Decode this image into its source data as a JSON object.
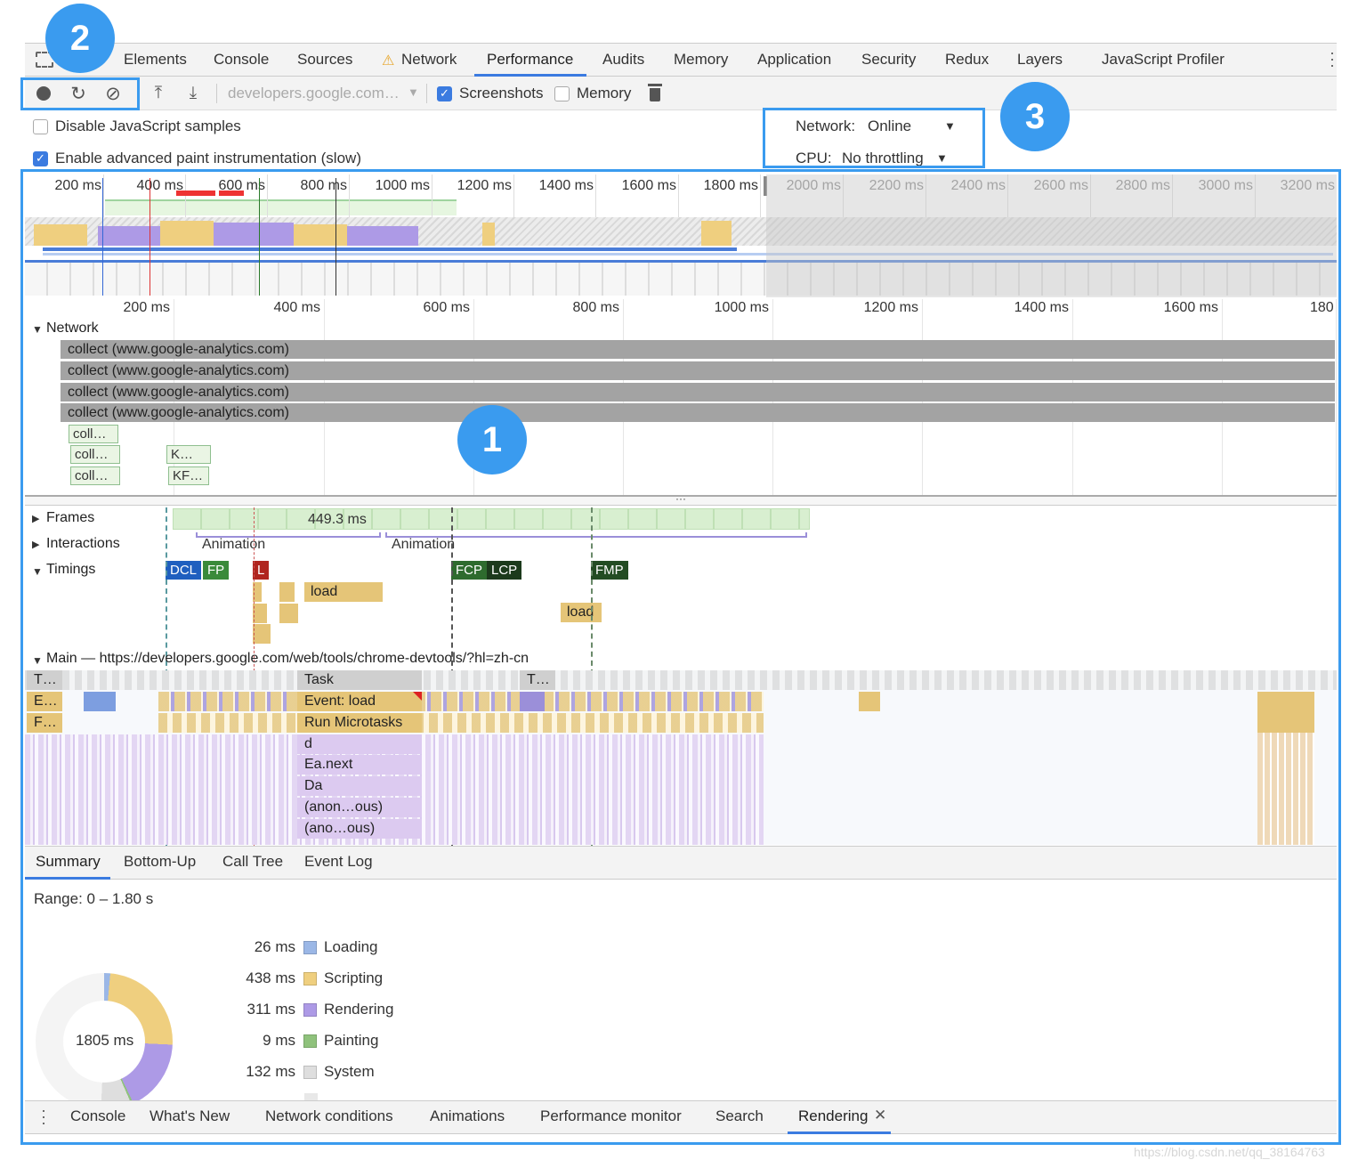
{
  "tabs": [
    {
      "label": "Elements",
      "name": "tab-elements"
    },
    {
      "label": "Console",
      "name": "tab-console"
    },
    {
      "label": "Sources",
      "name": "tab-sources"
    },
    {
      "label": "Network",
      "name": "tab-network",
      "warning": true
    },
    {
      "label": "Performance",
      "name": "tab-performance",
      "active": true
    },
    {
      "label": "Audits",
      "name": "tab-audits"
    },
    {
      "label": "Memory",
      "name": "tab-memory"
    },
    {
      "label": "Application",
      "name": "tab-application"
    },
    {
      "label": "Security",
      "name": "tab-security"
    },
    {
      "label": "Redux",
      "name": "tab-redux"
    },
    {
      "label": "Layers",
      "name": "tab-layers"
    },
    {
      "label": "JavaScript Profiler",
      "name": "tab-javascript-profiler"
    }
  ],
  "toolbar": {
    "profile_select": "developers.google.com…",
    "screenshots_label": "Screenshots",
    "screenshots_checked": true,
    "memory_label": "Memory",
    "memory_checked": false
  },
  "settings": {
    "disable_js_samples": "Disable JavaScript samples",
    "disable_js_samples_checked": false,
    "advanced_paint": "Enable advanced paint instrumentation (slow)",
    "advanced_paint_checked": true,
    "network_label": "Network:",
    "network_value": "Online",
    "cpu_label": "CPU:",
    "cpu_value": "No throttling"
  },
  "callouts": {
    "one": "1",
    "two": "2",
    "three": "3"
  },
  "overview_ticks": [
    "200 ms",
    "400 ms",
    "600 ms",
    "800 ms",
    "1000 ms",
    "1200 ms",
    "1400 ms",
    "1600 ms",
    "1800 ms",
    "2000 ms",
    "2200 ms",
    "2400 ms",
    "2600 ms",
    "2800 ms",
    "3000 ms",
    "3200 ms"
  ],
  "detail_ticks": [
    "200 ms",
    "400 ms",
    "600 ms",
    "800 ms",
    "1000 ms",
    "1200 ms",
    "1400 ms",
    "1600 ms",
    "180"
  ],
  "network": {
    "title": "Network",
    "rows": [
      "collect (www.google-analytics.com)",
      "collect (www.google-analytics.com)",
      "collect (www.google-analytics.com)",
      "collect (www.google-analytics.com)"
    ],
    "small": [
      "coll…",
      "coll…",
      "coll…",
      "K…",
      "KF…"
    ]
  },
  "tracks": {
    "frames": "Frames",
    "frames_duration": "449.3 ms",
    "interactions": "Interactions",
    "animation1": "Animation",
    "animation2": "Animation",
    "timings": "Timings",
    "load1": "load",
    "load2": "load",
    "markers": [
      {
        "label": "DCL",
        "color": "#1f5fbf"
      },
      {
        "label": "FP",
        "color": "#3a8a3a"
      },
      {
        "label": "L",
        "color": "#b0251f"
      },
      {
        "label": "FCP",
        "color": "#2e6b2e"
      },
      {
        "label": "LCP",
        "color": "#1c3a1c"
      },
      {
        "label": "FMP",
        "color": "#234c23"
      }
    ],
    "main": "Main — https://developers.google.com/web/tools/chrome-devtools/?hl=zh-cn"
  },
  "flame": {
    "left": [
      "T…",
      "E…",
      "F…"
    ],
    "stack": [
      "Task",
      "Event: load",
      "Run Microtasks",
      "d",
      "Ea.next",
      "Da",
      "(anon…ous)",
      "(ano…ous)"
    ],
    "task2": "T…"
  },
  "bottom_tabs": [
    "Summary",
    "Bottom-Up",
    "Call Tree",
    "Event Log"
  ],
  "summary": {
    "range": "Range: 0 – 1.80 s",
    "total": "1805 ms",
    "legend": [
      {
        "value": "26 ms",
        "label": "Loading",
        "color": "#9bb7e6"
      },
      {
        "value": "438 ms",
        "label": "Scripting",
        "color": "#efcf7f"
      },
      {
        "value": "311 ms",
        "label": "Rendering",
        "color": "#ad9ae6"
      },
      {
        "value": "9 ms",
        "label": "Painting",
        "color": "#8fc27c"
      },
      {
        "value": "132 ms",
        "label": "System",
        "color": "#dedede"
      }
    ]
  },
  "drawer_tabs": [
    "Console",
    "What's New",
    "Network conditions",
    "Animations",
    "Performance monitor",
    "Search",
    "Rendering"
  ],
  "watermark": "https://blog.csdn.net/qq_38164763"
}
